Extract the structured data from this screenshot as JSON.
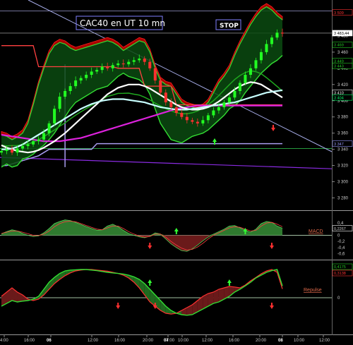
{
  "chart_data": [
    {
      "type": "line",
      "title": "CAC40 en UT 10 mn",
      "annotation_stop": "STOP",
      "ylim": [
        3270,
        3520
      ],
      "y_ticks": [
        "3 480",
        "3 460",
        "3 440",
        "3 420",
        "3 400",
        "3 380",
        "3 360",
        "3 340",
        "3 320",
        "3 300",
        "3 280"
      ],
      "right_tags": [
        {
          "text": "3 509",
          "value": 3509,
          "color": "#ff3030",
          "fill": "#000000"
        },
        {
          "text": "3 483,44",
          "value": 3483.44,
          "color": "#000000",
          "fill": "#ffffff"
        },
        {
          "text": "3 469",
          "value": 3469,
          "color": "#22cc22",
          "fill": "#000000"
        },
        {
          "text": "3 449",
          "value": 3449,
          "color": "#22cc22",
          "fill": "#000000"
        },
        {
          "text": "3 443",
          "value": 3443,
          "color": "#22cc22",
          "fill": "#000000"
        },
        {
          "text": "3 410",
          "value": 3410,
          "color": "#ffffff",
          "fill": "#000000"
        },
        {
          "text": "3 404",
          "value": 3404,
          "color": "#00ff66",
          "fill": "#000000"
        },
        {
          "text": "3 347",
          "value": 3347,
          "color": "#9999ff",
          "fill": "#000000"
        }
      ],
      "x_ticks": [
        "4:00",
        "16:00",
        "06",
        "12:00",
        "16:00",
        "20:00",
        "04:00",
        "07",
        "10:00",
        "12:00",
        "16:00",
        "20:00",
        "08",
        "10:00",
        "12:00"
      ],
      "close": [
        3338,
        3340,
        3336,
        3341,
        3344,
        3346,
        3350,
        3352,
        3360,
        3372,
        3390,
        3405,
        3412,
        3418,
        3425,
        3428,
        3432,
        3436,
        3438,
        3442,
        3440,
        3444,
        3446,
        3445,
        3448,
        3450,
        3452,
        3448,
        3440,
        3425,
        3410,
        3398,
        3392,
        3385,
        3380,
        3376,
        3374,
        3372,
        3376,
        3382,
        3388,
        3392,
        3398,
        3404,
        3412,
        3422,
        3432,
        3440,
        3450,
        3460,
        3470,
        3478,
        3484,
        3483
      ],
      "bb_upper": [
        3358,
        3356,
        3352,
        3355,
        3360,
        3372,
        3395,
        3420,
        3440,
        3458,
        3468,
        3472,
        3470,
        3465,
        3462,
        3464,
        3466,
        3468,
        3470,
        3472,
        3474,
        3472,
        3468,
        3462,
        3466,
        3470,
        3474,
        3472,
        3460,
        3440,
        3425,
        3420,
        3418,
        3408,
        3398,
        3394,
        3392,
        3390,
        3392,
        3398,
        3410,
        3422,
        3430,
        3440,
        3456,
        3470,
        3482,
        3494,
        3504,
        3512,
        3516,
        3512,
        3505,
        3500
      ],
      "bb_lower": [
        3318,
        3322,
        3318,
        3320,
        3328,
        3330,
        3334,
        3340,
        3345,
        3352,
        3360,
        3370,
        3380,
        3390,
        3398,
        3402,
        3406,
        3410,
        3414,
        3416,
        3418,
        3424,
        3430,
        3434,
        3430,
        3428,
        3426,
        3420,
        3408,
        3390,
        3372,
        3362,
        3352,
        3350,
        3348,
        3352,
        3356,
        3358,
        3360,
        3364,
        3370,
        3376,
        3382,
        3390,
        3394,
        3400,
        3410,
        3418,
        3426,
        3434,
        3440,
        3446,
        3450,
        3456
      ],
      "ma_white": [
        3345,
        3342,
        3340,
        3338,
        3337,
        3336,
        3337,
        3339,
        3342,
        3346,
        3350,
        3355,
        3360,
        3366,
        3372,
        3378,
        3384,
        3390,
        3396,
        3402,
        3408,
        3412,
        3416,
        3418,
        3420,
        3420,
        3420,
        3418,
        3415,
        3411,
        3407,
        3403,
        3399,
        3395,
        3392,
        3390,
        3389,
        3389,
        3390,
        3392,
        3395,
        3399,
        3404,
        3409,
        3414,
        3418,
        3421,
        3423,
        3422,
        3420,
        3416,
        3412,
        3408,
        3404
      ],
      "ma_cyan": [
        3340,
        3340,
        3341,
        3343,
        3346,
        3350,
        3354,
        3358,
        3362,
        3366,
        3370,
        3374,
        3378,
        3382,
        3386,
        3390,
        3393,
        3396,
        3398,
        3400,
        3401,
        3402,
        3402,
        3402,
        3401,
        3400,
        3399,
        3398,
        3396,
        3394,
        3392,
        3391,
        3390,
        3389,
        3389,
        3389,
        3390,
        3391,
        3392,
        3393,
        3394,
        3395,
        3396,
        3397,
        3398,
        3400,
        3402,
        3404,
        3406,
        3408,
        3410,
        3411,
        3412,
        3413
      ],
      "ma_magenta": [
        3358,
        3357,
        3356,
        3355,
        3354,
        3353,
        3352,
        3351,
        3350,
        3350,
        3350,
        3350,
        3351,
        3352,
        3353,
        3354,
        3356,
        3358,
        3360,
        3362,
        3364,
        3366,
        3368,
        3370,
        3372,
        3374,
        3376,
        3378,
        3380,
        3382,
        3384,
        3386,
        3388,
        3390,
        3391,
        3392,
        3393,
        3394,
        3394,
        3394,
        3394,
        3394,
        3394,
        3394,
        3394,
        3394,
        3394,
        3394,
        3394,
        3394,
        3394,
        3394,
        3394,
        3394
      ],
      "resistance_red": [
        3468,
        3468,
        3468,
        3468,
        3468,
        3468,
        3468,
        3442,
        3442,
        3442,
        3442,
        3442,
        3442,
        3442,
        3442,
        3442,
        3442,
        3442,
        3442,
        3442,
        3442,
        3442,
        3440,
        3440,
        3440,
        3440,
        3440,
        3418,
        3418,
        3418,
        3418,
        3418,
        3418,
        3395,
        3395,
        3395,
        3395,
        3395,
        3395,
        3395,
        3395,
        3395,
        3395,
        3395,
        3395,
        3395,
        3395,
        3395,
        3395,
        3395,
        3395,
        3395,
        3395,
        3395
      ],
      "support_lavender": [
        3320,
        3320,
        3322,
        3324,
        3326,
        3328,
        3330,
        3332,
        3336,
        3340,
        3340,
        3340,
        3340,
        3340,
        3340,
        3340,
        3340,
        3340,
        3347,
        3347,
        3347,
        3347,
        3347,
        3347,
        3347,
        3347,
        3347,
        3347,
        3347,
        3347,
        3347,
        3347,
        3347,
        3347,
        3347,
        3347,
        3347,
        3347,
        3347,
        3347,
        3347,
        3347,
        3347,
        3347,
        3347,
        3347,
        3347,
        3347,
        3347,
        3347,
        3347,
        3347,
        3347,
        3347
      ]
    },
    {
      "type": "area",
      "label": "MACD",
      "ylim": [
        -0.7,
        0.7
      ],
      "y_ticks": [
        "0,4",
        "0,2",
        "0",
        "-0,2",
        "-0,4",
        "-0,6"
      ],
      "tag": {
        "text": "0,2267",
        "value": 0.2267
      },
      "values": [
        0.05,
        0.12,
        0.18,
        0.14,
        0.06,
        0.0,
        -0.04,
        -0.02,
        0.08,
        0.22,
        0.38,
        0.45,
        0.5,
        0.48,
        0.42,
        0.35,
        0.28,
        0.22,
        0.16,
        0.18,
        0.3,
        0.36,
        0.28,
        0.16,
        0.06,
        0.0,
        -0.05,
        -0.08,
        -0.03,
        0.08,
        0.04,
        -0.12,
        -0.28,
        -0.4,
        -0.5,
        -0.52,
        -0.44,
        -0.32,
        -0.18,
        -0.06,
        0.04,
        0.12,
        0.2,
        0.3,
        0.32,
        0.24,
        0.16,
        0.1,
        0.2,
        0.38,
        0.45,
        0.42,
        0.3,
        0.23
      ],
      "signal": [
        0.06,
        0.1,
        0.14,
        0.14,
        0.1,
        0.05,
        0.0,
        -0.01,
        0.04,
        0.14,
        0.28,
        0.38,
        0.44,
        0.46,
        0.44,
        0.38,
        0.32,
        0.26,
        0.2,
        0.18,
        0.24,
        0.3,
        0.3,
        0.22,
        0.12,
        0.04,
        -0.02,
        -0.06,
        -0.04,
        0.04,
        0.04,
        -0.06,
        -0.2,
        -0.32,
        -0.42,
        -0.48,
        -0.46,
        -0.38,
        -0.26,
        -0.12,
        0.0,
        0.08,
        0.16,
        0.24,
        0.28,
        0.26,
        0.2,
        0.14,
        0.16,
        0.3,
        0.4,
        0.42,
        0.36,
        0.28
      ],
      "up_arrows": [
        33,
        46
      ],
      "down_arrows": [
        28,
        51
      ]
    },
    {
      "type": "area",
      "label": "Repulse",
      "ylim": [
        -1.2,
        1.2
      ],
      "y_ticks": [
        "0"
      ],
      "tags": [
        {
          "text": "0,4175",
          "value": 0.4175,
          "color": "#22cc22"
        },
        {
          "text": "0,3138",
          "value": 0.3138,
          "color": "#ff3030"
        }
      ],
      "green": [
        -0.3,
        -0.2,
        -0.1,
        -0.15,
        -0.12,
        -0.1,
        -0.05,
        0.05,
        0.3,
        0.55,
        0.72,
        0.86,
        0.95,
        0.98,
        0.99,
        1.0,
        1.0,
        0.98,
        0.96,
        0.93,
        0.9,
        0.88,
        0.86,
        0.84,
        0.8,
        0.74,
        0.65,
        0.5,
        0.3,
        0.1,
        -0.1,
        -0.3,
        -0.45,
        -0.55,
        -0.6,
        -0.62,
        -0.6,
        -0.5,
        -0.4,
        -0.3,
        -0.2,
        -0.15,
        -0.05,
        0.05,
        0.2,
        0.3,
        0.42,
        0.55,
        0.7,
        0.8,
        0.9,
        0.96,
        1.0,
        0.42
      ],
      "red": [
        0.05,
        0.2,
        0.35,
        0.2,
        0.1,
        -0.05,
        -0.1,
        -0.05,
        0.1,
        0.3,
        0.5,
        0.65,
        0.78,
        0.88,
        0.95,
        0.98,
        1.0,
        1.0,
        0.98,
        0.96,
        0.94,
        0.9,
        0.86,
        0.8,
        0.7,
        0.55,
        0.35,
        0.1,
        -0.15,
        -0.3,
        -0.45,
        -0.55,
        -0.58,
        -0.55,
        -0.45,
        -0.35,
        -0.25,
        -0.1,
        0.05,
        0.15,
        0.2,
        0.3,
        0.35,
        0.4,
        0.38,
        0.35,
        0.45,
        0.6,
        0.72,
        0.85,
        0.95,
        1.0,
        0.9,
        0.31
      ],
      "up_arrows": [
        28,
        43
      ],
      "down_arrows": [
        22,
        29,
        51
      ]
    }
  ]
}
